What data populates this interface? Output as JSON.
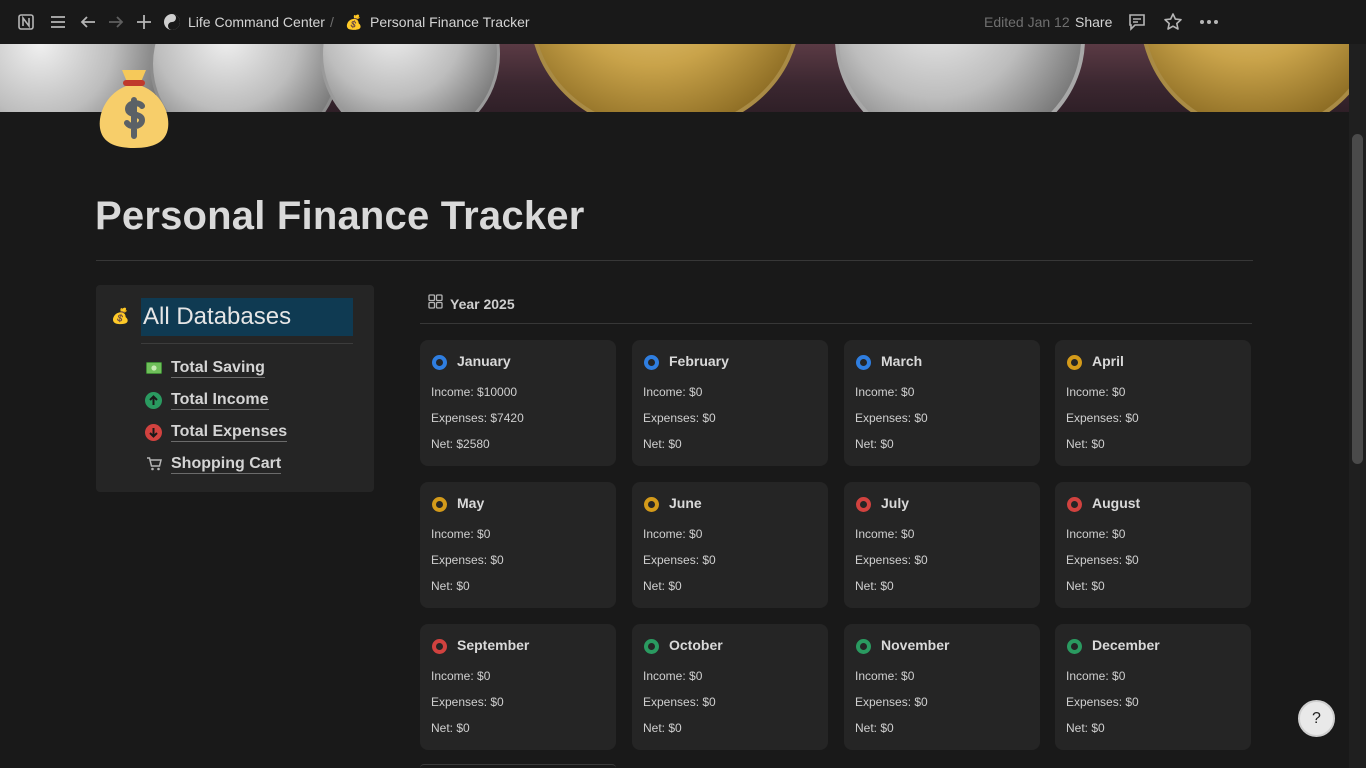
{
  "topbar": {
    "workspace": "Life Command Center",
    "separator": "/",
    "page": "Personal Finance Tracker",
    "edited": "Edited Jan 12",
    "share": "Share",
    "icons": [
      "notion-logo-icon",
      "menu-icon",
      "back-arrow-icon",
      "forward-arrow-icon",
      "add-icon",
      "workspace-icon",
      "money-bag-icon",
      "comment-icon",
      "star-icon",
      "more-icon"
    ]
  },
  "page": {
    "title": "Personal Finance Tracker",
    "icon": "money-bag-icon"
  },
  "left_panel": {
    "heading": "All Databases",
    "links": [
      {
        "label": "Total Saving",
        "icon": "dollar-bill-icon"
      },
      {
        "label": "Total Income",
        "icon": "up-arrow-circle-icon"
      },
      {
        "label": "Total Expenses",
        "icon": "down-arrow-circle-icon"
      },
      {
        "label": "Shopping Cart",
        "icon": "shopping-cart-icon"
      }
    ]
  },
  "gallery": {
    "title": "Year 2025",
    "months": [
      {
        "name": "January",
        "income": "Income: $10000",
        "expenses": "Expenses: $7420",
        "net": "Net: $2580",
        "color": "#2f7ee0"
      },
      {
        "name": "February",
        "income": "Income: $0",
        "expenses": "Expenses: $0",
        "net": "Net: $0",
        "color": "#2f7ee0"
      },
      {
        "name": "March",
        "income": "Income: $0",
        "expenses": "Expenses: $0",
        "net": "Net: $0",
        "color": "#2f7ee0"
      },
      {
        "name": "April",
        "income": "Income: $0",
        "expenses": "Expenses: $0",
        "net": "Net: $0",
        "color": "#d39a1a"
      },
      {
        "name": "May",
        "income": "Income: $0",
        "expenses": "Expenses: $0",
        "net": "Net: $0",
        "color": "#d39a1a"
      },
      {
        "name": "June",
        "income": "Income: $0",
        "expenses": "Expenses: $0",
        "net": "Net: $0",
        "color": "#d39a1a"
      },
      {
        "name": "July",
        "income": "Income: $0",
        "expenses": "Expenses: $0",
        "net": "Net: $0",
        "color": "#d1423f"
      },
      {
        "name": "August",
        "income": "Income: $0",
        "expenses": "Expenses: $0",
        "net": "Net: $0",
        "color": "#d1423f"
      },
      {
        "name": "September",
        "income": "Income: $0",
        "expenses": "Expenses: $0",
        "net": "Net: $0",
        "color": "#d1423f"
      },
      {
        "name": "October",
        "income": "Income: $0",
        "expenses": "Expenses: $0",
        "net": "Net: $0",
        "color": "#2a9a60"
      },
      {
        "name": "November",
        "income": "Income: $0",
        "expenses": "Expenses: $0",
        "net": "Net: $0",
        "color": "#2a9a60"
      },
      {
        "name": "December",
        "income": "Income: $0",
        "expenses": "Expenses: $0",
        "net": "Net: $0",
        "color": "#2a9a60"
      }
    ]
  },
  "help_button": {
    "label": "?",
    "icon": "help-icon"
  }
}
